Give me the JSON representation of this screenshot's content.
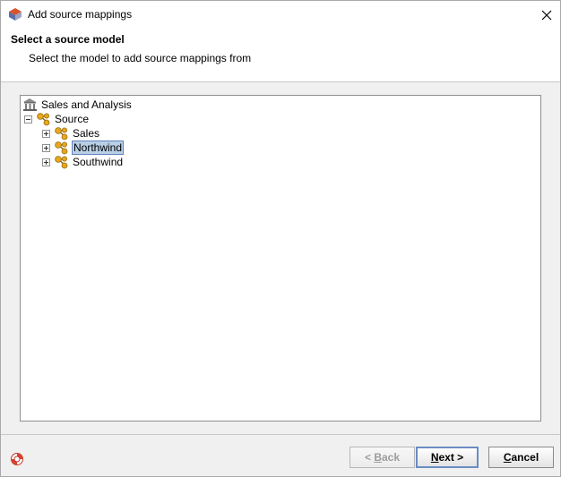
{
  "window": {
    "title": "Add source mappings",
    "icon": "app-logo-icon"
  },
  "header": {
    "title": "Select a source model",
    "description": "Select the model to add source mappings from"
  },
  "tree": {
    "root": {
      "label": "Sales and Analysis",
      "icon": "bank-icon"
    },
    "source": {
      "label": "Source",
      "icon": "model-icon",
      "expanded": true
    },
    "children": [
      {
        "label": "Sales",
        "icon": "model-icon",
        "expanded": false,
        "selected": false
      },
      {
        "label": "Northwind",
        "icon": "model-icon",
        "expanded": false,
        "selected": true
      },
      {
        "label": "Southwind",
        "icon": "model-icon",
        "expanded": false,
        "selected": false
      }
    ]
  },
  "buttons": {
    "back": {
      "prefix": "< ",
      "mnemonic": "B",
      "rest": "ack",
      "enabled": false
    },
    "next": {
      "mnemonic": "N",
      "rest": "ext >",
      "enabled": true
    },
    "cancel": {
      "mnemonic": "C",
      "rest": "ancel",
      "enabled": true
    }
  },
  "colors": {
    "selection": "#b8cfe5",
    "selection_border": "#6382bf",
    "icon_gold": "#e5a81e"
  }
}
